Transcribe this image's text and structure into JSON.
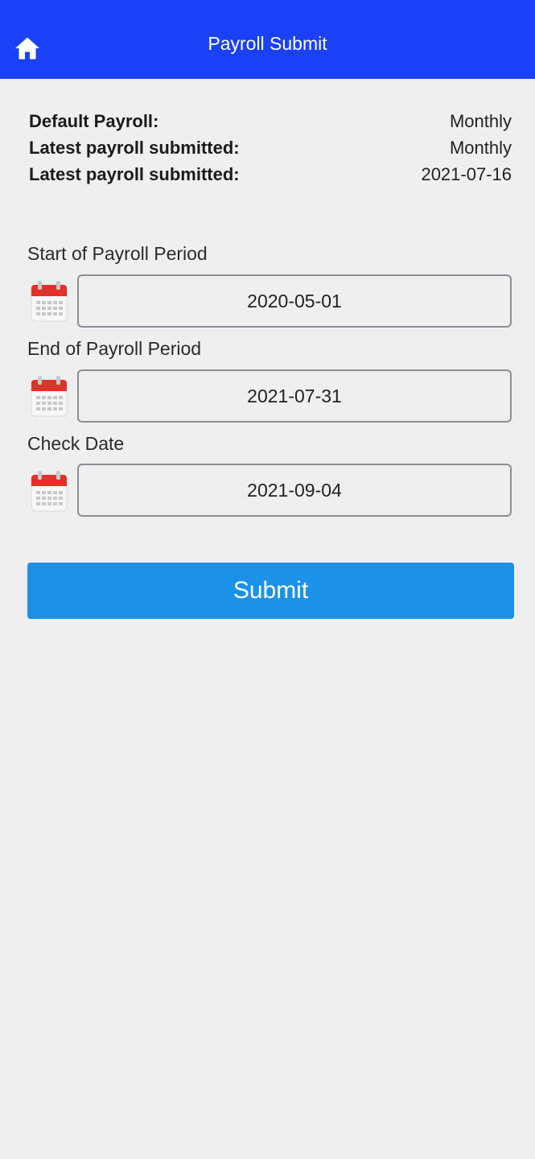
{
  "header": {
    "title": "Payroll Submit",
    "home_icon": "home-icon"
  },
  "summary": [
    {
      "label": "Default Payroll:",
      "value": "Monthly"
    },
    {
      "label": "Latest payroll submitted:",
      "value": "Monthly"
    },
    {
      "label": "Latest payroll submitted:",
      "value": "2021-07-16"
    }
  ],
  "fields": {
    "start": {
      "label": "Start of Payroll Period",
      "value": "2020-05-01",
      "icon": "calendar-icon"
    },
    "end": {
      "label": "End of Payroll Period",
      "value": "2021-07-31",
      "icon": "calendar-icon"
    },
    "check": {
      "label": "Check Date",
      "value": "2021-09-04",
      "icon": "calendar-icon"
    }
  },
  "actions": {
    "submit_label": "Submit"
  },
  "colors": {
    "header_bg": "#1a41f5",
    "button_bg": "#1b92e8",
    "calendar_red": "#e0322a",
    "page_bg": "#efefef"
  }
}
